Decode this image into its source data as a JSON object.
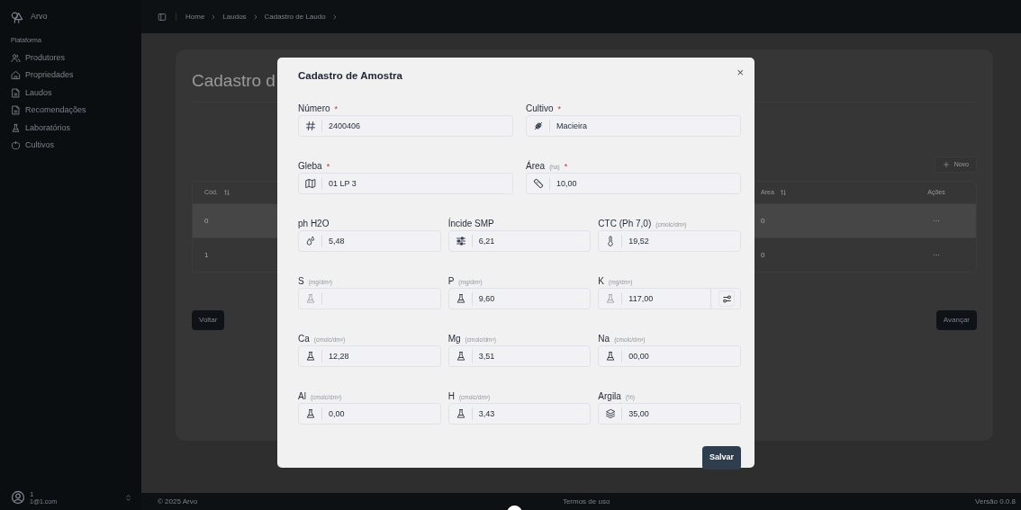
{
  "sidebar": {
    "brand": "Arvo",
    "section": "Plataforma",
    "items": [
      {
        "label": "Produtores"
      },
      {
        "label": "Propriedades"
      },
      {
        "label": "Laudos"
      },
      {
        "label": "Recomendações"
      },
      {
        "label": "Laboratórios"
      },
      {
        "label": "Cultivos"
      }
    ],
    "user": {
      "name": "1",
      "email": "1@1.com"
    }
  },
  "breadcrumb": [
    "Home",
    "Laudos",
    "Cadastro de Laudo"
  ],
  "page": {
    "title": "Cadastro d",
    "new_button": "Novo",
    "table": {
      "columns": [
        {
          "label": "Cód."
        },
        {
          "label": "Area"
        },
        {
          "label": "Ações"
        }
      ],
      "rows": [
        {
          "code": "0",
          "area": "0",
          "actions": "···",
          "selected": true
        },
        {
          "code": "1",
          "area": "0",
          "actions": "···",
          "selected": false
        }
      ]
    },
    "back_button": "Voltar",
    "next_button": "Avançar"
  },
  "modal": {
    "title": "Cadastro de Amostra",
    "close": "×",
    "save_button": "Salvar",
    "rows": [
      [
        {
          "label": "Número",
          "required_mark": "*",
          "value": "2400406",
          "icon_faded": false,
          "action_button": false
        },
        {
          "label": "Cultivo",
          "required_mark": "*",
          "value": "Macieira",
          "icon_faded": false,
          "action_button": false
        }
      ],
      [
        {
          "label": "Gleba",
          "required_mark": "*",
          "value": "01 LP 3",
          "icon_faded": false,
          "action_button": false
        },
        {
          "label": "Área",
          "unit": "(ha)",
          "required_mark": "*",
          "value": "10,00",
          "icon_faded": false,
          "action_button": false
        }
      ],
      [
        {
          "label": "ph H2O",
          "value": "5,48",
          "icon_faded": false,
          "action_button": false
        },
        {
          "label": "Íncide SMP",
          "value": "6,21",
          "icon_faded": false,
          "action_button": false
        },
        {
          "label": "CTC (Ph 7,0)",
          "unit": "(cmolc/dm³)",
          "value": "19,52",
          "icon_faded": false,
          "action_button": false
        }
      ],
      [
        {
          "label": "S",
          "unit": "(mg/dm³)",
          "icon_faded": true,
          "action_button": false
        },
        {
          "label": "P",
          "unit": "(mg/dm³)",
          "value": "9,60",
          "icon_faded": false,
          "action_button": false
        },
        {
          "label": "K",
          "unit": "(mg/dm³)",
          "value": "117,00",
          "icon_faded": true,
          "action_button": true
        }
      ],
      [
        {
          "label": "Ca",
          "unit": "(cmolc/dm³)",
          "value": "12,28",
          "icon_faded": false,
          "action_button": false
        },
        {
          "label": "Mg",
          "unit": "(cmolc/dm³)",
          "value": "3,51",
          "icon_faded": false,
          "action_button": false
        },
        {
          "label": "Na",
          "unit": "(cmolc/dm³)",
          "value": "00,00",
          "icon_faded": false,
          "action_button": false
        }
      ],
      [
        {
          "label": "Al",
          "unit": "(cmolc/dm³)",
          "value": "0,00",
          "icon_faded": false,
          "action_button": false
        },
        {
          "label": "H",
          "unit": "(cmolc/dm³)",
          "value": "3,43",
          "icon_faded": false,
          "action_button": false
        },
        {
          "label": "Argila",
          "unit": "(%)",
          "value": "35,00",
          "icon_faded": false,
          "action_button": false
        }
      ]
    ]
  },
  "footer": {
    "copyright": "© 2025 Arvo",
    "terms": "Termos de uso",
    "version": "Versão 0.0.8"
  }
}
